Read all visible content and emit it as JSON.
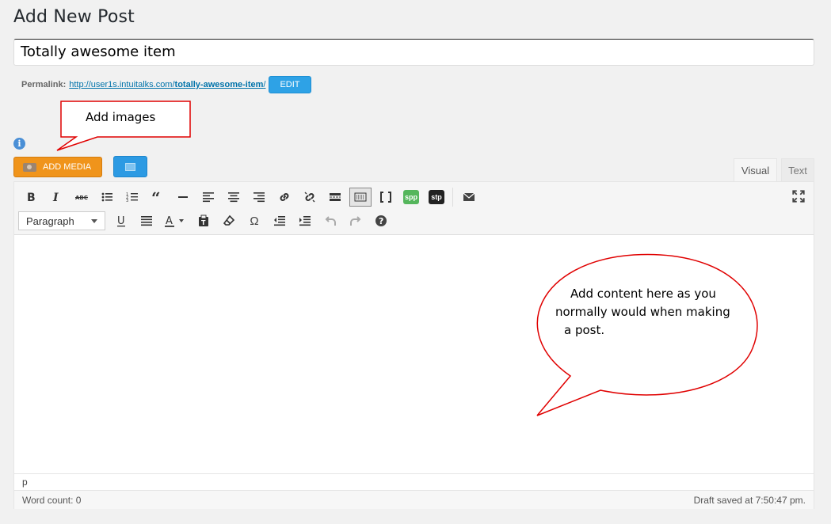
{
  "page": {
    "title": "Add New Post"
  },
  "post": {
    "title_value": "Totally awesome item"
  },
  "permalink": {
    "label": "Permalink:",
    "url_prefix": "http://user1s.intuitalks.com/",
    "url_slug": "totally-awesome-item",
    "url_suffix": "/",
    "edit_label": "EDIT"
  },
  "media": {
    "add_media_label": "ADD MEDIA",
    "info_icon": "i"
  },
  "tabs": {
    "visual": "Visual",
    "text": "Text"
  },
  "toolbar": {
    "row1_icons": [
      "bold-icon",
      "italic-icon",
      "strikethrough-icon",
      "bulleted-list-icon",
      "numbered-list-icon",
      "blockquote-icon",
      "horizontal-line-icon",
      "align-left-icon",
      "align-center-icon",
      "align-right-icon",
      "link-icon",
      "unlink-icon",
      "read-more-icon",
      "toolbar-toggle-icon",
      "distraction-free-icon",
      "spp-icon",
      "stp-icon",
      "email-icon",
      "fullscreen-icon"
    ],
    "spp_label": "spp",
    "stp_label": "stp",
    "format_select": "Paragraph",
    "row2_icons": [
      "underline-icon",
      "justify-icon",
      "text-color-icon",
      "paste-as-text-icon",
      "clear-formatting-icon",
      "special-character-icon",
      "outdent-icon",
      "indent-icon",
      "undo-icon",
      "redo-icon",
      "help-icon"
    ],
    "omega": "Ω",
    "help": "?"
  },
  "editor": {
    "path": "p",
    "word_count": "Word count: 0",
    "draft_status": "Draft saved at 7:50:47 pm."
  },
  "callouts": {
    "images": "Add images",
    "content_line1": "Add content here as you",
    "content_line2": "normally would when making",
    "content_line3": "a post.",
    "stroke_color": "#e00000"
  },
  "colors": {
    "edit_button": "#2ea2e6",
    "add_media_button": "#f0941b",
    "link": "#0073aa"
  }
}
